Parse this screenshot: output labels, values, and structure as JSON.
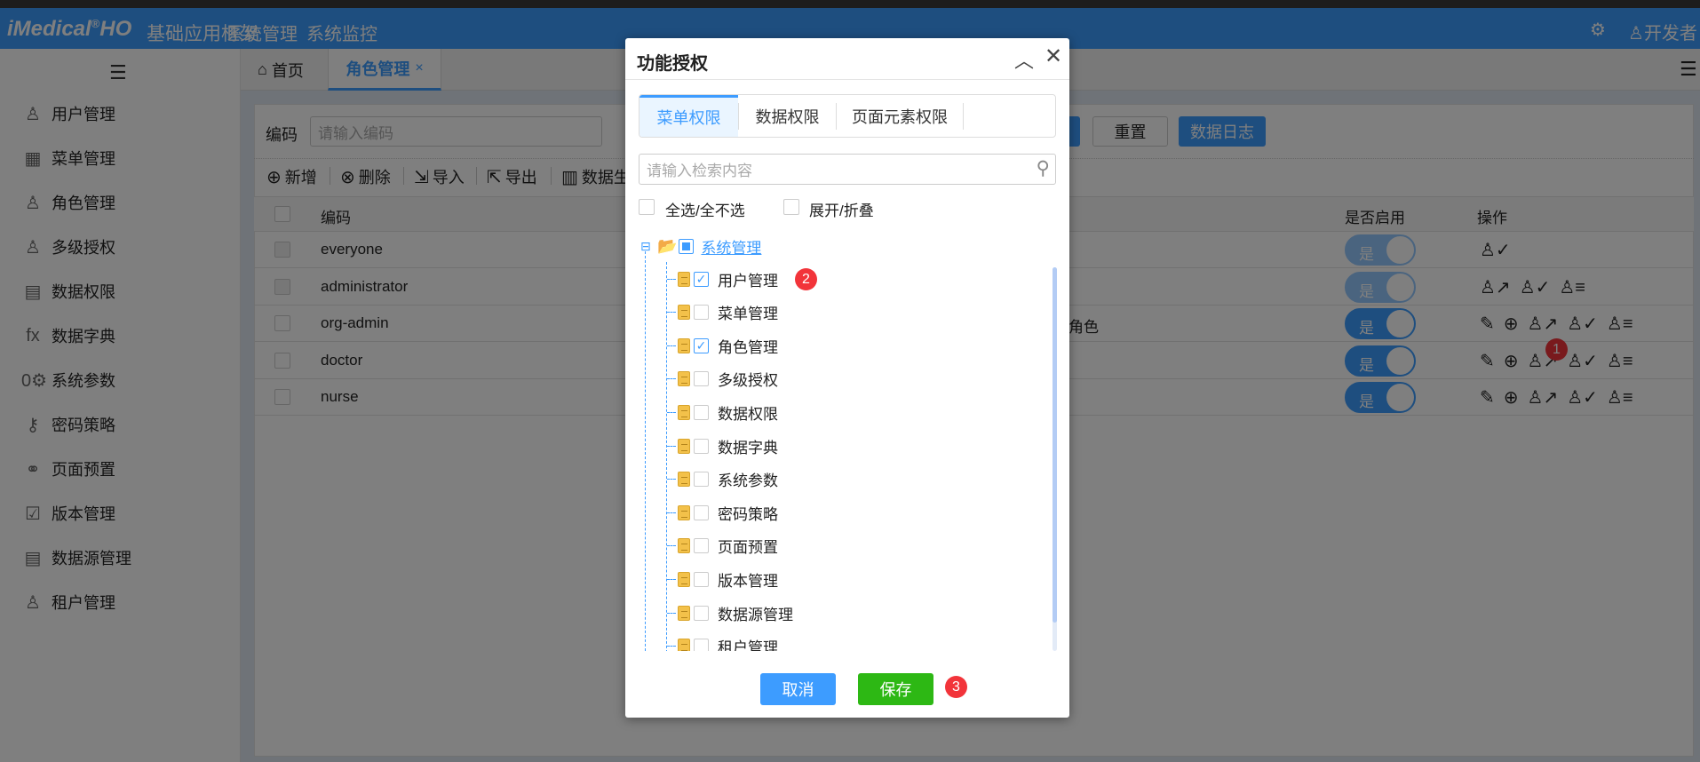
{
  "header": {
    "logo": "iMedical",
    "logo_reg": "®",
    "logo_suffix": "HO",
    "app_title": "基础应用框架",
    "nav": [
      "系统管理",
      "系统监控"
    ],
    "user": "开发者",
    "gear_icon": "gear-icon",
    "user_icon": "user-icon"
  },
  "sidebar": {
    "items": [
      {
        "label": "用户管理",
        "icon": "user-icon",
        "glyph": "♙"
      },
      {
        "label": "菜单管理",
        "icon": "grid-icon",
        "glyph": "▦"
      },
      {
        "label": "角色管理",
        "icon": "role-icon",
        "glyph": "♙"
      },
      {
        "label": "多级授权",
        "icon": "user-check-icon",
        "glyph": "♙"
      },
      {
        "label": "数据权限",
        "icon": "data-table-icon",
        "glyph": "▤"
      },
      {
        "label": "数据字典",
        "icon": "fx-icon",
        "glyph": "fx"
      },
      {
        "label": "系统参数",
        "icon": "param-icon",
        "glyph": "0⚙"
      },
      {
        "label": "密码策略",
        "icon": "key-icon",
        "glyph": "⚷"
      },
      {
        "label": "页面预置",
        "icon": "circles-icon",
        "glyph": "⚭"
      },
      {
        "label": "版本管理",
        "icon": "save-icon",
        "glyph": "☑"
      },
      {
        "label": "数据源管理",
        "icon": "clipboard-icon",
        "glyph": "▤"
      },
      {
        "label": "租户管理",
        "icon": "tenant-icon",
        "glyph": "♙"
      }
    ]
  },
  "tabs": {
    "home": "首页",
    "role": "角色管理",
    "close": "×"
  },
  "search": {
    "label": "编码",
    "placeholder": "请输入编码",
    "reset": "重置",
    "log": "数据日志"
  },
  "toolbar": [
    {
      "label": "新增",
      "glyph": "⊕"
    },
    {
      "label": "删除",
      "glyph": "⊗"
    },
    {
      "label": "导入",
      "glyph": "⇲"
    },
    {
      "label": "导出",
      "glyph": "⇱"
    },
    {
      "label": "数据生",
      "glyph": "▥"
    }
  ],
  "table": {
    "headers": {
      "code": "编码",
      "enabled": "是否启用",
      "ops": "操作"
    },
    "rows": [
      {
        "code": "everyone",
        "desc": "",
        "enabled": "是",
        "disabled_toggle": true,
        "ops": [
          "♙✓"
        ]
      },
      {
        "code": "administrator",
        "desc": "",
        "enabled": "是",
        "disabled_toggle": true,
        "ops": [
          "♙↗",
          "♙✓",
          "♙≡"
        ]
      },
      {
        "code": "org-admin",
        "desc": "角色",
        "enabled": "是",
        "disabled_toggle": false,
        "ops": [
          "✎",
          "⊕",
          "♙↗",
          "♙✓",
          "♙≡"
        ]
      },
      {
        "code": "doctor",
        "desc": "",
        "enabled": "是",
        "disabled_toggle": false,
        "ops": [
          "✎",
          "⊕",
          "♙↗",
          "♙✓",
          "♙≡"
        ]
      },
      {
        "code": "nurse",
        "desc": "",
        "enabled": "是",
        "disabled_toggle": false,
        "ops": [
          "✎",
          "⊕",
          "♙↗",
          "♙✓",
          "♙≡"
        ]
      }
    ]
  },
  "modal": {
    "title": "功能授权",
    "tabs": [
      "菜单权限",
      "数据权限",
      "页面元素权限"
    ],
    "active_tab": 0,
    "search_placeholder": "请输入检索内容",
    "select_all": "全选/全不选",
    "expand": "展开/折叠",
    "root": "系统管理",
    "children": [
      {
        "label": "用户管理",
        "checked": true
      },
      {
        "label": "菜单管理",
        "checked": false
      },
      {
        "label": "角色管理",
        "checked": true
      },
      {
        "label": "多级授权",
        "checked": false
      },
      {
        "label": "数据权限",
        "checked": false
      },
      {
        "label": "数据字典",
        "checked": false
      },
      {
        "label": "系统参数",
        "checked": false
      },
      {
        "label": "密码策略",
        "checked": false
      },
      {
        "label": "页面预置",
        "checked": false
      },
      {
        "label": "版本管理",
        "checked": false
      },
      {
        "label": "数据源管理",
        "checked": false
      },
      {
        "label": "租户管理",
        "checked": false
      }
    ],
    "cancel": "取消",
    "save": "保存"
  },
  "badges": [
    "1",
    "2",
    "3"
  ],
  "colors": {
    "primary": "#3d9cff",
    "save": "#2db814",
    "badge": "#f2343a"
  }
}
